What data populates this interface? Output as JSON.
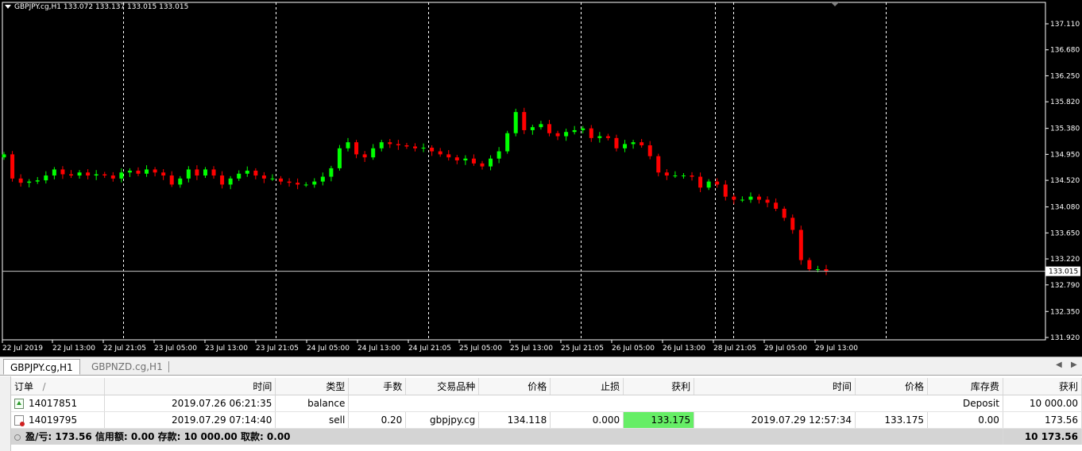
{
  "chart": {
    "symbol_header": "GBPJPY.cg,H1  133.072 133.137 133.015 133.015",
    "current_price_label": "133.015",
    "colors": {
      "background": "#000000",
      "bull": "#00ff00",
      "bear": "#ff0000",
      "grid": "#ffffff",
      "text": "#ffffff"
    },
    "price_levels": [
      "137.110",
      "136.680",
      "136.250",
      "135.820",
      "135.380",
      "134.950",
      "134.520",
      "134.080",
      "133.650",
      "133.220",
      "132.790",
      "132.350",
      "131.920"
    ],
    "time_labels": [
      "22 Jul 2019",
      "22 Jul 13:00",
      "22 Jul 21:05",
      "23 Jul 05:00",
      "23 Jul 13:00",
      "23 Jul 21:05",
      "24 Jul 05:00",
      "24 Jul 13:00",
      "24 Jul 21:05",
      "25 Jul 05:00",
      "25 Jul 13:00",
      "25 Jul 21:05",
      "26 Jul 05:00",
      "26 Jul 13:00",
      "28 Jul 21:05",
      "29 Jul 05:00",
      "29 Jul 13:00"
    ]
  },
  "chart_data": {
    "type": "candlestick",
    "symbol": "GBPJPY.cg",
    "timeframe": "H1",
    "ylim": [
      131.92,
      137.11
    ],
    "current_price": 133.015,
    "grid": false,
    "closes": [
      134.95,
      134.55,
      134.48,
      134.5,
      134.52,
      134.6,
      134.7,
      134.62,
      134.6,
      134.65,
      134.6,
      134.62,
      134.6,
      134.55,
      134.65,
      134.68,
      134.63,
      134.7,
      134.65,
      134.6,
      134.45,
      134.55,
      134.7,
      134.6,
      134.7,
      134.6,
      134.45,
      134.55,
      134.63,
      134.68,
      134.6,
      134.55,
      134.55,
      134.5,
      134.48,
      134.45,
      134.45,
      134.5,
      134.58,
      134.72,
      135.05,
      135.15,
      134.95,
      134.9,
      135.05,
      135.15,
      135.12,
      135.1,
      135.08,
      135.05,
      135.06,
      135.0,
      134.95,
      134.9,
      134.85,
      134.88,
      134.8,
      134.75,
      134.88,
      135.0,
      135.3,
      135.65,
      135.35,
      135.4,
      135.45,
      135.3,
      135.25,
      135.32,
      135.35,
      135.38,
      135.22,
      135.25,
      135.22,
      135.05,
      135.12,
      135.15,
      135.1,
      134.92,
      134.65,
      134.6,
      134.6,
      134.6,
      134.58,
      134.4,
      134.5,
      134.45,
      134.25,
      134.2,
      134.2,
      134.25,
      134.2,
      134.15,
      134.05,
      133.9,
      133.7,
      133.2,
      133.05,
      133.05,
      133.015
    ]
  },
  "tabs": [
    {
      "label": "GBPJPY.cg,H1"
    },
    {
      "label": "GBPNZD.cg,H1"
    }
  ],
  "terminal": {
    "columns": [
      "订单",
      "/",
      "时间",
      "类型",
      "手数",
      "交易品种",
      "价格",
      "止损",
      "获利",
      "时间",
      "价格",
      "库存费",
      "获利"
    ],
    "rows": [
      {
        "order": "14017851",
        "time": "2019.07.26 06:21:35",
        "type": "balance",
        "comment": "Deposit",
        "profit": "10 000.00"
      },
      {
        "order": "14019795",
        "time": "2019.07.29 07:14:40",
        "type": "sell",
        "lots": "0.20",
        "symbol": "gbpjpy.cg",
        "price": "134.118",
        "sl": "0.000",
        "tp": "133.175",
        "close_time": "2019.07.29 12:57:34",
        "close_price": "133.175",
        "swap": "0.00",
        "profit": "173.56"
      }
    ],
    "summary": {
      "text": "盈/亏: 173.56  信用额: 0.00  存款: 10 000.00  取款: 0.00",
      "total": "10 173.56"
    }
  }
}
